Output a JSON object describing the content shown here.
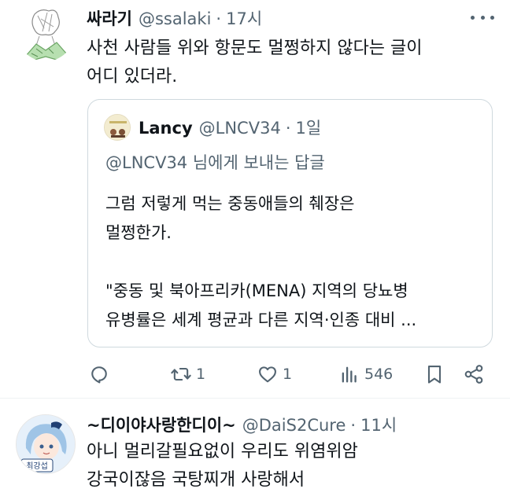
{
  "tweets": [
    {
      "display_name": "싸라기",
      "handle": "@ssalaki",
      "time": "17시",
      "text": "사천 사람들 위와 항문도 멀쩡하지 않다는 글이\n어디 있더라.",
      "quote": {
        "display_name": "Lancy",
        "handle": "@LNCV34",
        "time": "1일",
        "reply_to": "@LNCV34 님에게 보내는 답글",
        "text": "그럼 저렇게 먹는 중동애들의 췌장은\n멀쩡한가.\n\n\"중동 및 북아프리카(MENA) 지역의 당뇨병\n유병률은 세계 평균과 다른 지역·인종 대비 ..."
      },
      "actions": {
        "reply_icon": "reply-icon",
        "retweet_icon": "retweet-icon",
        "retweet_count": "1",
        "like_icon": "heart-icon",
        "like_count": "1",
        "views_icon": "views-icon",
        "views_count": "546",
        "bookmark_icon": "bookmark-icon",
        "share_icon": "share-icon"
      }
    },
    {
      "display_name": "~디이야사랑한디이~",
      "handle": "@DaiS2Cure",
      "time": "11시",
      "text": "아니 멀리갈필요없이 우리도 위염위암\n강국이잖음 국탕찌개 사랑해서",
      "avatar_label": "최강섭"
    }
  ],
  "separator": "·",
  "colors": {
    "text_primary": "#0f1419",
    "text_secondary": "#536471",
    "border": "#cfd9de"
  }
}
